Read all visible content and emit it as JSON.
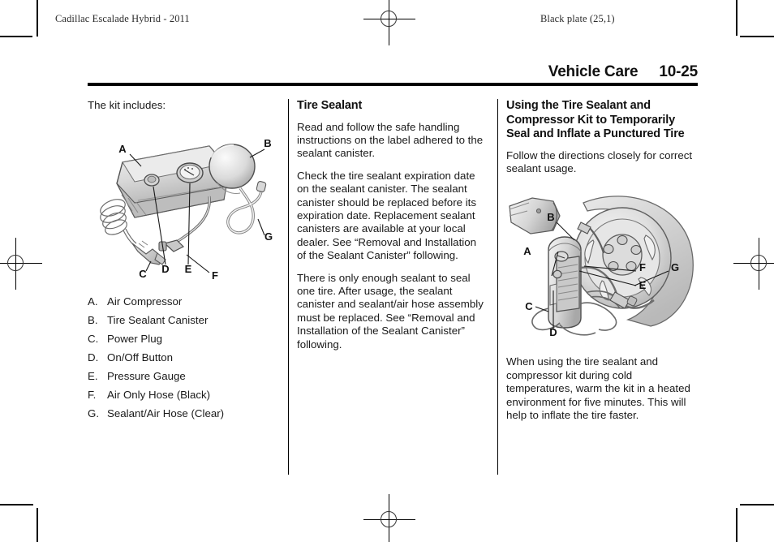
{
  "page": {
    "slug_left": "Cadillac Escalade Hybrid - 2011",
    "slug_right": "Black plate (25,1)",
    "header_title": "Vehicle Care",
    "header_page": "10-25",
    "rule_color": "#000000"
  },
  "column_left": {
    "intro": "The kit includes:",
    "figure": {
      "name": "tire-sealant-compressor-kit-diagram",
      "callouts": [
        "A",
        "B",
        "C",
        "D",
        "E",
        "F",
        "G"
      ]
    },
    "legend": [
      {
        "key": "A.",
        "text": "Air Compressor"
      },
      {
        "key": "B.",
        "text": "Tire Sealant Canister"
      },
      {
        "key": "C.",
        "text": "Power Plug"
      },
      {
        "key": "D.",
        "text": "On/Off Button"
      },
      {
        "key": "E.",
        "text": "Pressure Gauge"
      },
      {
        "key": "F.",
        "text": "Air Only Hose (Black)"
      },
      {
        "key": "G.",
        "text": "Sealant/Air Hose (Clear)"
      }
    ]
  },
  "column_middle": {
    "heading": "Tire Sealant",
    "paragraphs": [
      "Read and follow the safe handling instructions on the label adhered to the sealant canister.",
      "Check the tire sealant expiration date on the sealant canister. The sealant canister should be replaced before its expiration date. Replacement sealant canisters are available at your local dealer. See “Removal and Installation of the Sealant Canister” following.",
      "There is only enough sealant to seal one tire. After usage, the sealant canister and sealant/air hose assembly must be replaced. See “Removal and Installation of the Sealant Canister” following."
    ]
  },
  "column_right": {
    "heading": "Using the Tire Sealant and Compressor Kit to Temporarily Seal and Inflate a Punctured Tire",
    "paragraph_top": "Follow the directions closely for correct sealant usage.",
    "figure": {
      "name": "kit-connected-to-wheel-diagram",
      "callouts": [
        "A",
        "B",
        "C",
        "D",
        "E",
        "F",
        "G"
      ]
    },
    "paragraph_bottom": "When using the tire sealant and compressor kit during cold temperatures, warm the kit in a heated environment for five minutes. This will help to inflate the tire faster."
  }
}
